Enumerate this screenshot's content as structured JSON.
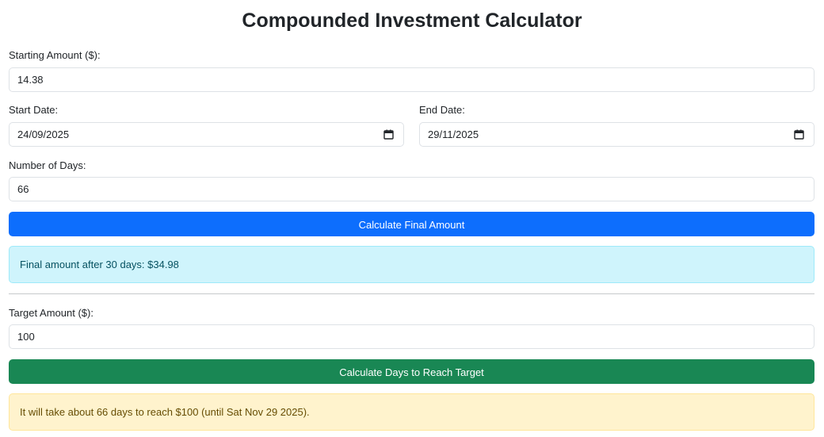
{
  "page_title": "Compounded Investment Calculator",
  "starting_amount": {
    "label": "Starting Amount ($):",
    "value": "14.38"
  },
  "start_date": {
    "label": "Start Date:",
    "value": "24/09/2025"
  },
  "end_date": {
    "label": "End Date:",
    "value": "29/11/2025"
  },
  "number_of_days": {
    "label": "Number of Days:",
    "value": "66"
  },
  "calculate_final_button": "Calculate Final Amount",
  "final_result": "Final amount after 30 days: $34.98",
  "target_amount": {
    "label": "Target Amount ($):",
    "value": "100"
  },
  "calculate_days_button": "Calculate Days to Reach Target",
  "days_result": "It will take about 66 days to reach $100 (until Sat Nov 29 2025).",
  "icons": {
    "date_picker": "calendar-icon"
  },
  "colors": {
    "primary": "#0d6efd",
    "success": "#198754",
    "info_bg": "#cff4fc",
    "warning_bg": "#fff3cd"
  }
}
